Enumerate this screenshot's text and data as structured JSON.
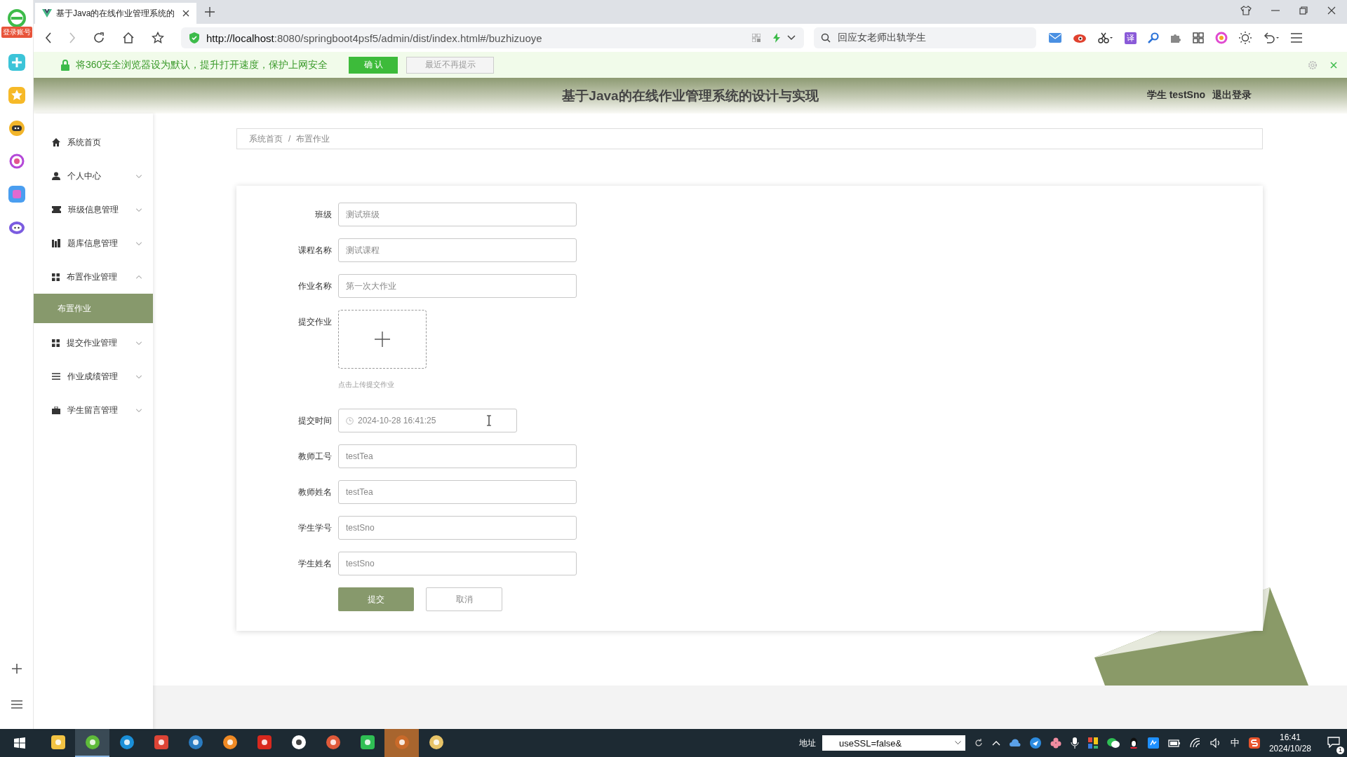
{
  "launcher": {
    "badge": "登录账号"
  },
  "browser": {
    "tab_title": "基于Java的在线作业管理系统的",
    "url_host": "http://localhost",
    "url_rest": ":8080/springboot4psf5/admin/dist/index.html#/buzhizuoye",
    "search_text": "回应女老师出轨学生",
    "translate_label": "译"
  },
  "notice": {
    "text": "将360安全浏览器设为默认，提升打开速度，保护上网安全",
    "confirm": "确 认",
    "dismiss": "最近不再提示"
  },
  "header": {
    "title": "基于Java的在线作业管理系统的设计与实现",
    "user": "学生 testSno",
    "logout": "退出登录"
  },
  "sidebar": {
    "items": [
      {
        "label": "系统首页",
        "kind": "link"
      },
      {
        "label": "个人中心",
        "kind": "menu",
        "expanded": false
      },
      {
        "label": "班级信息管理",
        "kind": "menu",
        "expanded": false
      },
      {
        "label": "题库信息管理",
        "kind": "menu",
        "expanded": false
      },
      {
        "label": "布置作业管理",
        "kind": "menu",
        "expanded": true,
        "children": [
          {
            "label": "布置作业",
            "selected": true
          }
        ]
      },
      {
        "label": "提交作业管理",
        "kind": "menu",
        "expanded": false
      },
      {
        "label": "作业成绩管理",
        "kind": "menu",
        "expanded": false
      },
      {
        "label": "学生留言管理",
        "kind": "menu",
        "expanded": false
      }
    ]
  },
  "breadcrumb": {
    "separator": "/",
    "items": [
      "系统首页",
      "布置作业"
    ]
  },
  "form": {
    "fields": [
      {
        "label": "班级",
        "kind": "text",
        "value": "测试班级"
      },
      {
        "label": "课程名称",
        "kind": "text",
        "value": "测试课程"
      },
      {
        "label": "作业名称",
        "kind": "text",
        "value": "第一次大作业"
      },
      {
        "label": "提交作业",
        "kind": "upload",
        "hint": "点击上传提交作业"
      },
      {
        "label": "提交时间",
        "kind": "date",
        "value": "2024-10-28 16:41:25"
      },
      {
        "label": "教师工号",
        "kind": "text",
        "value": "testTea"
      },
      {
        "label": "教师姓名",
        "kind": "text",
        "value": "testTea"
      },
      {
        "label": "学生学号",
        "kind": "text",
        "value": "testSno"
      },
      {
        "label": "学生姓名",
        "kind": "text",
        "value": "testSno"
      }
    ],
    "submit": "提交",
    "cancel": "取消"
  },
  "taskbar": {
    "address_label": "地址",
    "address_value": "useSSL=false&",
    "ime": "中",
    "time": "16:41",
    "date": "2024/10/28",
    "notifications": "1"
  }
}
